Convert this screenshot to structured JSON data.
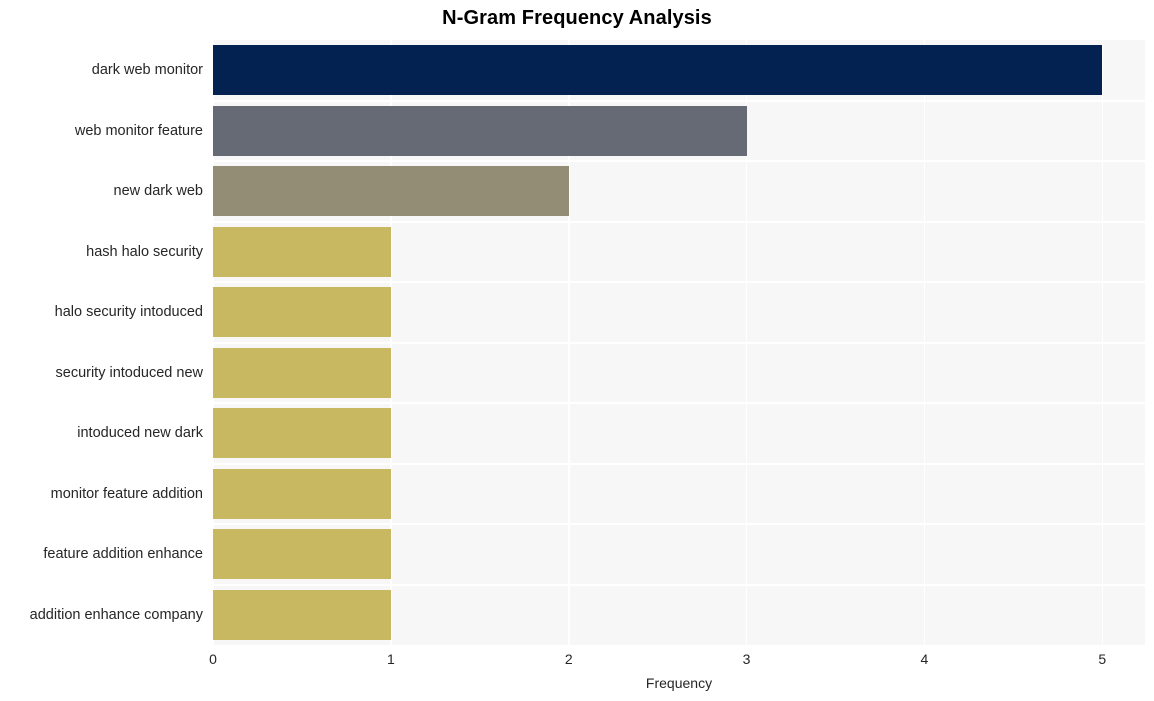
{
  "chart_data": {
    "type": "bar",
    "orientation": "horizontal",
    "title": "N-Gram Frequency Analysis",
    "xlabel": "Frequency",
    "ylabel": "",
    "categories": [
      "dark web monitor",
      "web monitor feature",
      "new dark web",
      "hash halo security",
      "halo security intoduced",
      "security intoduced new",
      "intoduced new dark",
      "monitor feature addition",
      "feature addition enhance",
      "addition enhance company"
    ],
    "values": [
      5,
      3,
      2,
      1,
      1,
      1,
      1,
      1,
      1,
      1
    ],
    "bar_colors": [
      "#042251",
      "#666a74",
      "#948d76",
      "#c8b862",
      "#c8b862",
      "#c8b862",
      "#c8b862",
      "#c8b862",
      "#c8b862",
      "#c8b862"
    ],
    "xlim": [
      0,
      5.24
    ],
    "xticks": [
      0,
      1,
      2,
      3,
      4,
      5
    ],
    "xtick_labels": [
      "0",
      "1",
      "2",
      "3",
      "4",
      "5"
    ],
    "grid": true,
    "grid_color": "#ffffff",
    "plot_background": "#f7f7f7",
    "figure_background": "#ffffff",
    "legend": null,
    "legend_position": "none"
  },
  "colors": {
    "title_text": "#000000",
    "tick_text": "#262626",
    "plot_bg": "#f7f7f7",
    "page_bg": "#ffffff",
    "gridline": "#ffffff"
  }
}
